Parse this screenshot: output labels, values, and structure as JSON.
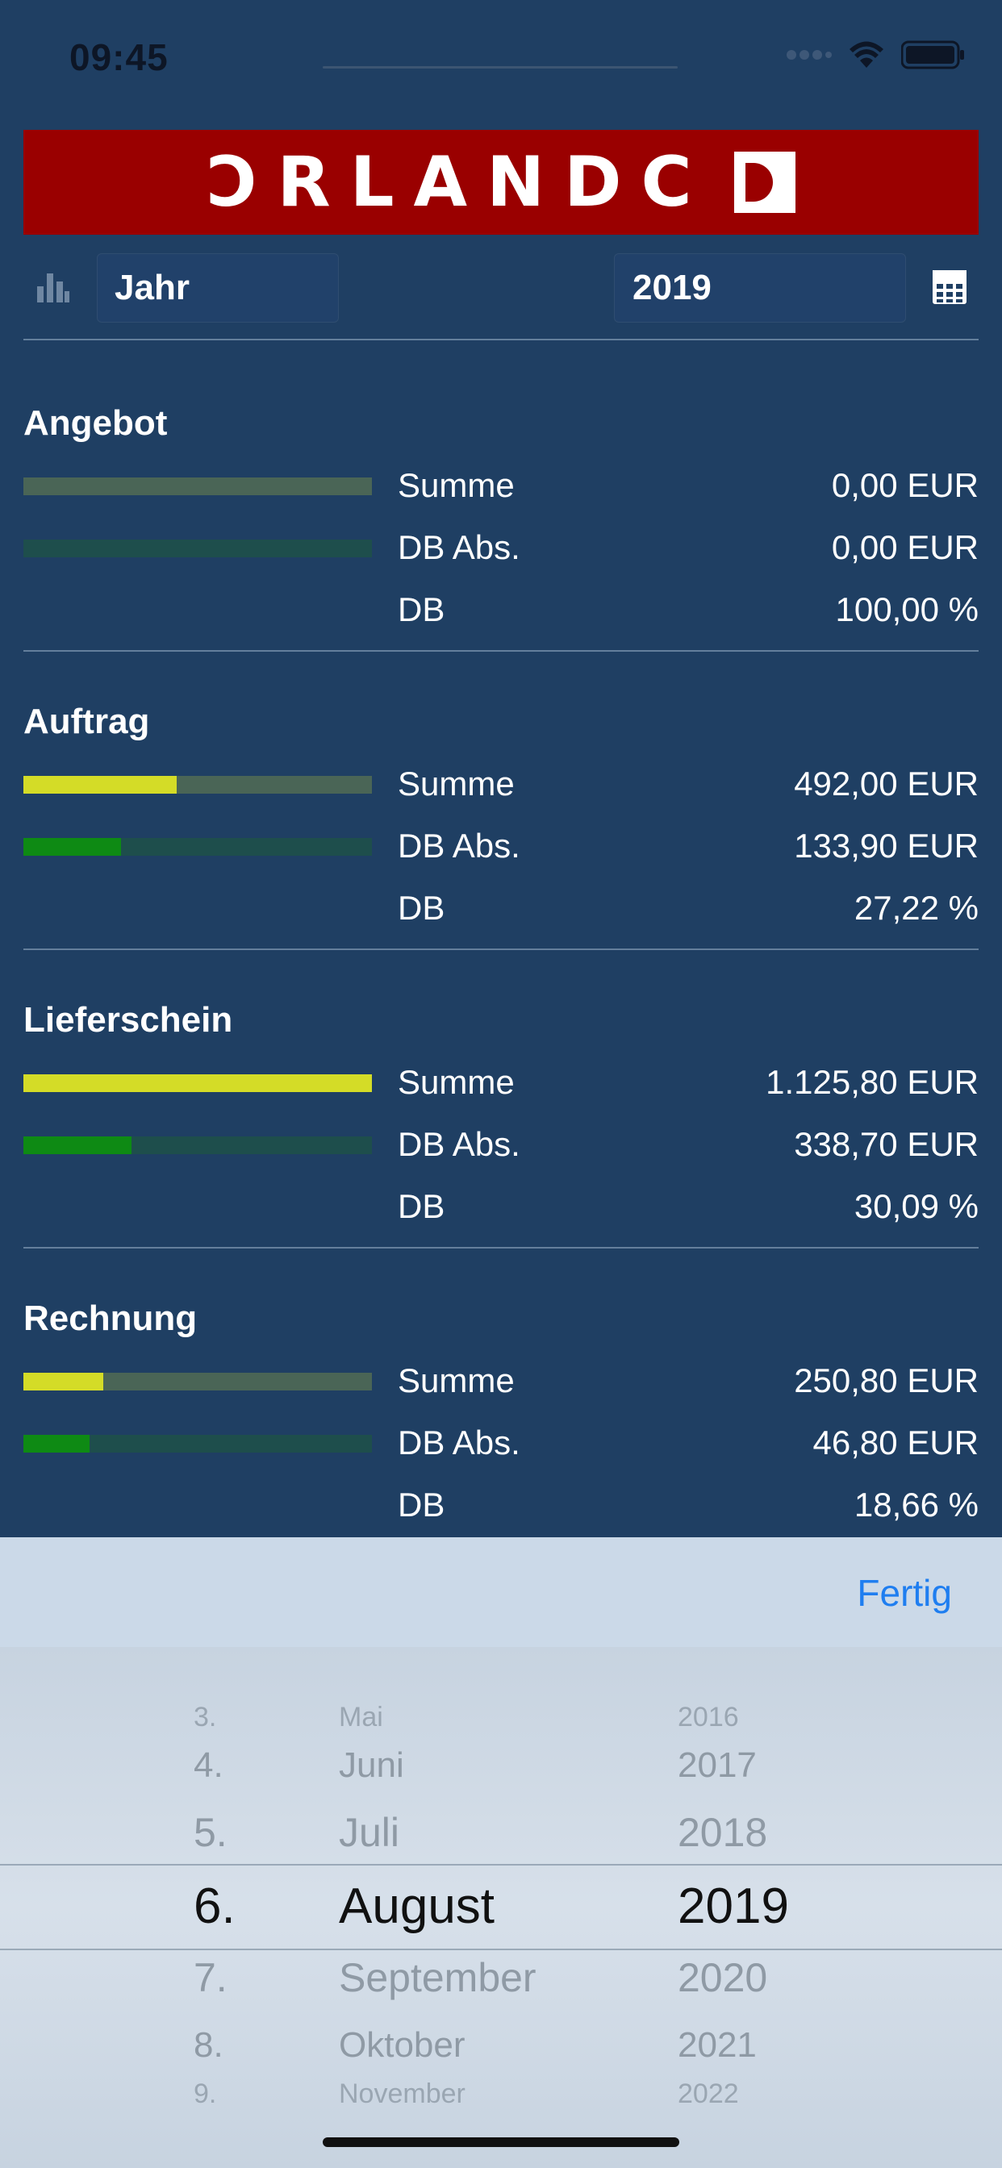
{
  "status": {
    "time": "09:45"
  },
  "header": {
    "period_label": "Jahr",
    "year_value": "2019"
  },
  "sections": [
    {
      "title": "Angebot",
      "rows": [
        {
          "label": "Summe",
          "value": "0,00 EUR",
          "fill": 0.0
        },
        {
          "label": "DB Abs.",
          "value": "0,00 EUR",
          "fill": 0.0
        },
        {
          "label": "DB",
          "value": "100,00 %"
        }
      ]
    },
    {
      "title": "Auftrag",
      "rows": [
        {
          "label": "Summe",
          "value": "492,00 EUR",
          "fill": 0.44
        },
        {
          "label": "DB Abs.",
          "value": "133,90 EUR",
          "fill": 0.28
        },
        {
          "label": "DB",
          "value": "27,22 %"
        }
      ]
    },
    {
      "title": "Lieferschein",
      "rows": [
        {
          "label": "Summe",
          "value": "1.125,80 EUR",
          "fill": 1.0
        },
        {
          "label": "DB Abs.",
          "value": "338,70 EUR",
          "fill": 0.31
        },
        {
          "label": "DB",
          "value": "30,09 %"
        }
      ]
    },
    {
      "title": "Rechnung",
      "rows": [
        {
          "label": "Summe",
          "value": "250,80 EUR",
          "fill": 0.23
        },
        {
          "label": "DB Abs.",
          "value": "46,80 EUR",
          "fill": 0.19
        },
        {
          "label": "DB",
          "value": "18,66 %"
        }
      ]
    }
  ],
  "picker": {
    "done_label": "Fertig",
    "days": [
      "3.",
      "4.",
      "5.",
      "6.",
      "7.",
      "8.",
      "9."
    ],
    "months": [
      "Mai",
      "Juni",
      "Juli",
      "August",
      "September",
      "Oktober",
      "November"
    ],
    "years": [
      "2016",
      "2017",
      "2018",
      "2019",
      "2020",
      "2021",
      "2022"
    ],
    "selected_index": 3
  },
  "colors": {
    "background": "#1f3f63",
    "logo_red": "#9a0000",
    "summe_fill": "#d4dc27",
    "summe_track": "#4a6556",
    "db_fill": "#0e8a14",
    "db_track": "#1e4e4c",
    "accent_blue": "#1f7ef0"
  }
}
